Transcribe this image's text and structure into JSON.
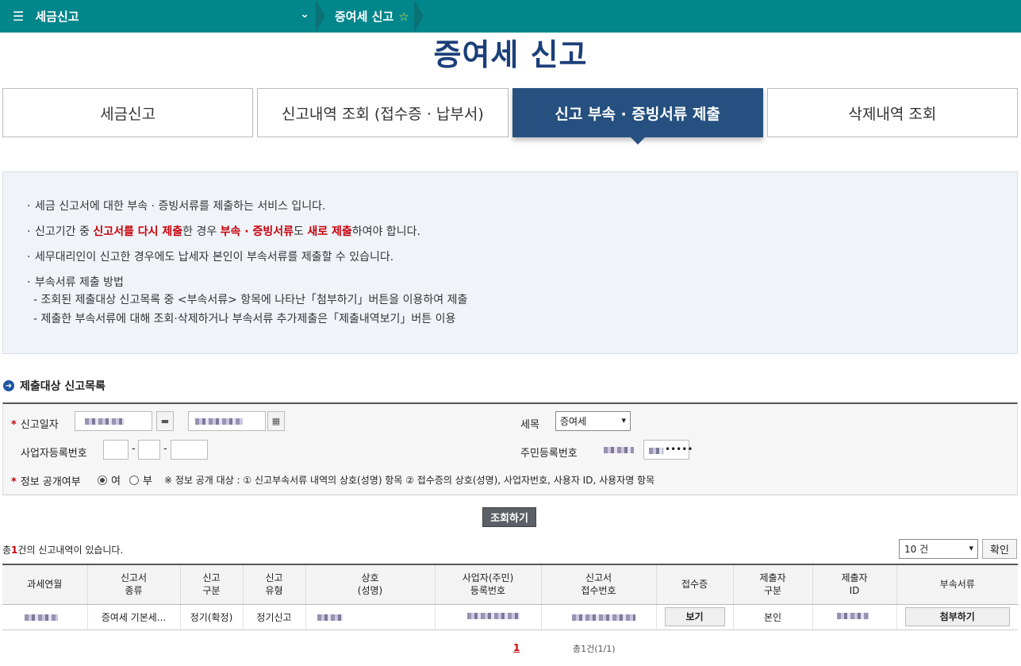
{
  "topbar": {
    "menu_label": "세금신고",
    "breadcrumb": "증여세 신고"
  },
  "page_title": "증여세 신고",
  "tabs": [
    {
      "label": "세금신고",
      "active": false
    },
    {
      "label": "신고내역 조회 (접수증 · 납부서)",
      "active": false
    },
    {
      "label": "신고 부속 · 증빙서류 제출",
      "active": true
    },
    {
      "label": "삭제내역 조회",
      "active": false
    }
  ],
  "info": {
    "line1": "세금 신고서에 대한 부속 · 증빙서류를 제출하는 서비스 입니다.",
    "line2_a": "신고기간 중 ",
    "line2_b": "신고서를 다시 제출",
    "line2_c": "한 경우 ",
    "line2_d": "부속 · 증빙서류",
    "line2_e": "도 ",
    "line2_f": "새로 제출",
    "line2_g": "하여야 합니다.",
    "line3": "세무대리인이 신고한 경우에도 납세자 본인이 부속서류를 제출할 수 있습니다.",
    "line4": "부속서류 제출 방법",
    "line4_sub1": "- 조회된 제출대상 신고목록 중 <부속서류> 항목에 나타난「첨부하기」버튼을 이용하여 제출",
    "line4_sub2": "- 제출한 부속서류에 대해 조회·삭제하거나 부속서류 추가제출은「제출내역보기」버튼 이용"
  },
  "section_title": "제출대상 신고목록",
  "form": {
    "report_date_label": "신고일자",
    "tax_item_label": "세목",
    "tax_item_value": "증여세",
    "biz_no_label": "사업자등록번호",
    "resident_no_label": "주민등록번호",
    "resident_no_suffix": "•••••",
    "disclosure_label": "정보 공개여부",
    "radio_yes": "여",
    "radio_no": "부",
    "disclosure_note": "※ 정보 공개 대상 : ① 신고부속서류 내역의 상호(성명) 항목 ② 접수증의 상호(성명), 사업자번호, 사용자 ID, 사용자명 항목",
    "search_button": "조회하기"
  },
  "results": {
    "count_prefix": "총",
    "count_value": "1",
    "count_suffix": "건의 신고내역이 있습니다.",
    "page_size": "10 건",
    "confirm_button": "확인",
    "headers": [
      [
        "과세연월"
      ],
      [
        "신고서",
        "종류"
      ],
      [
        "신고",
        "구분"
      ],
      [
        "신고",
        "유형"
      ],
      [
        "상호",
        "(성명)"
      ],
      [
        "사업자(주민)",
        "등록번호"
      ],
      [
        "신고서",
        "접수번호"
      ],
      [
        "접수증"
      ],
      [
        "제출자",
        "구분"
      ],
      [
        "제출자",
        "ID"
      ],
      [
        "부속서류"
      ]
    ],
    "row": {
      "form_type": "증여세 기본세...",
      "report_kind": "정기(확정)",
      "report_type": "정기신고",
      "view_button": "보기",
      "submitter_type": "본인",
      "attach_button": "첨부하기"
    }
  },
  "pager": {
    "current": "1",
    "total": "총1건(1/1)"
  }
}
